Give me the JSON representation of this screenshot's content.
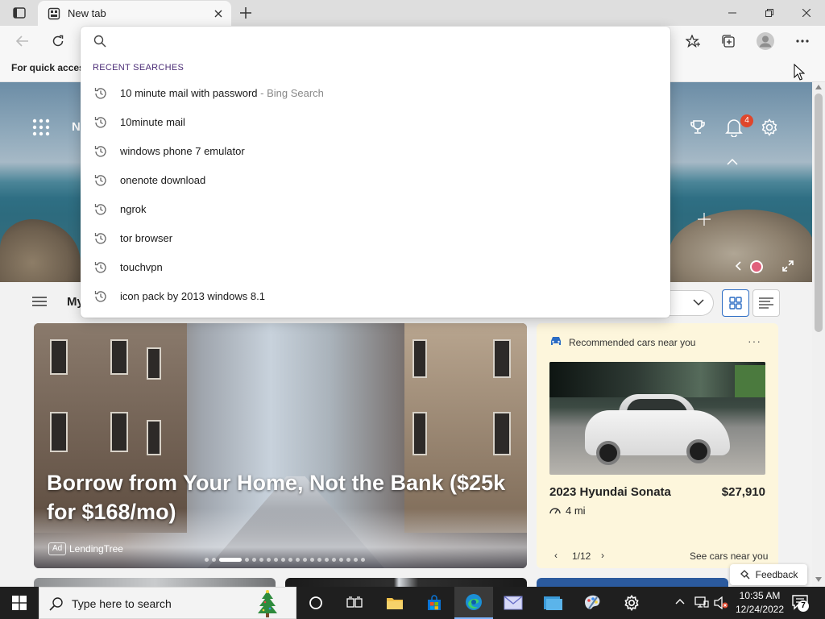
{
  "browser": {
    "tab_title": "New tab",
    "favorites_bar_text": "For quick access",
    "icons": [
      "tab-actions-icon",
      "new-tab-icon",
      "close-icon",
      "minimize-icon",
      "restore-icon",
      "back-icon",
      "refresh-icon",
      "favorites-icon",
      "collections-icon",
      "profile-icon",
      "more-icon"
    ]
  },
  "omnibox": {
    "query": "",
    "recent_header": "RECENT SEARCHES",
    "suggestions": [
      {
        "text": "10 minute mail with password",
        "sub": " - Bing Search"
      },
      {
        "text": "10minute mail",
        "sub": ""
      },
      {
        "text": "windows phone 7 emulator",
        "sub": ""
      },
      {
        "text": "onenote download",
        "sub": ""
      },
      {
        "text": "ngrok",
        "sub": ""
      },
      {
        "text": "tor browser",
        "sub": ""
      },
      {
        "text": "touchvpn",
        "sub": ""
      },
      {
        "text": "icon pack by 2013 windows 8.1",
        "sub": ""
      }
    ]
  },
  "newtab": {
    "nav_initial": "N",
    "notifications_count": "4",
    "my_label": "My",
    "hero_card": {
      "title": "Borrow from Your Home, Not the Bank ($25k for $168/mo)",
      "ad_badge": "Ad",
      "source": "LendingTree"
    },
    "cars_card": {
      "header": "Recommended cars near you",
      "more": "···",
      "car_name": "2023 Hyundai Sonata",
      "price": "$27,910",
      "distance": "4 mi",
      "pager": "1/12",
      "see_more": "See cars near you"
    },
    "feedback": "Feedback"
  },
  "taskbar": {
    "search_placeholder": "Type here to search",
    "time": "10:35 AM",
    "date": "12/24/2022",
    "notifications": "7"
  },
  "colors": {
    "accent": "#2b6cc4",
    "notification_badge": "#e0462b",
    "recent_header": "#4b2c76",
    "cars_card_bg": "#fdf6dc",
    "taskbar_bg": "#1f1f1f"
  }
}
